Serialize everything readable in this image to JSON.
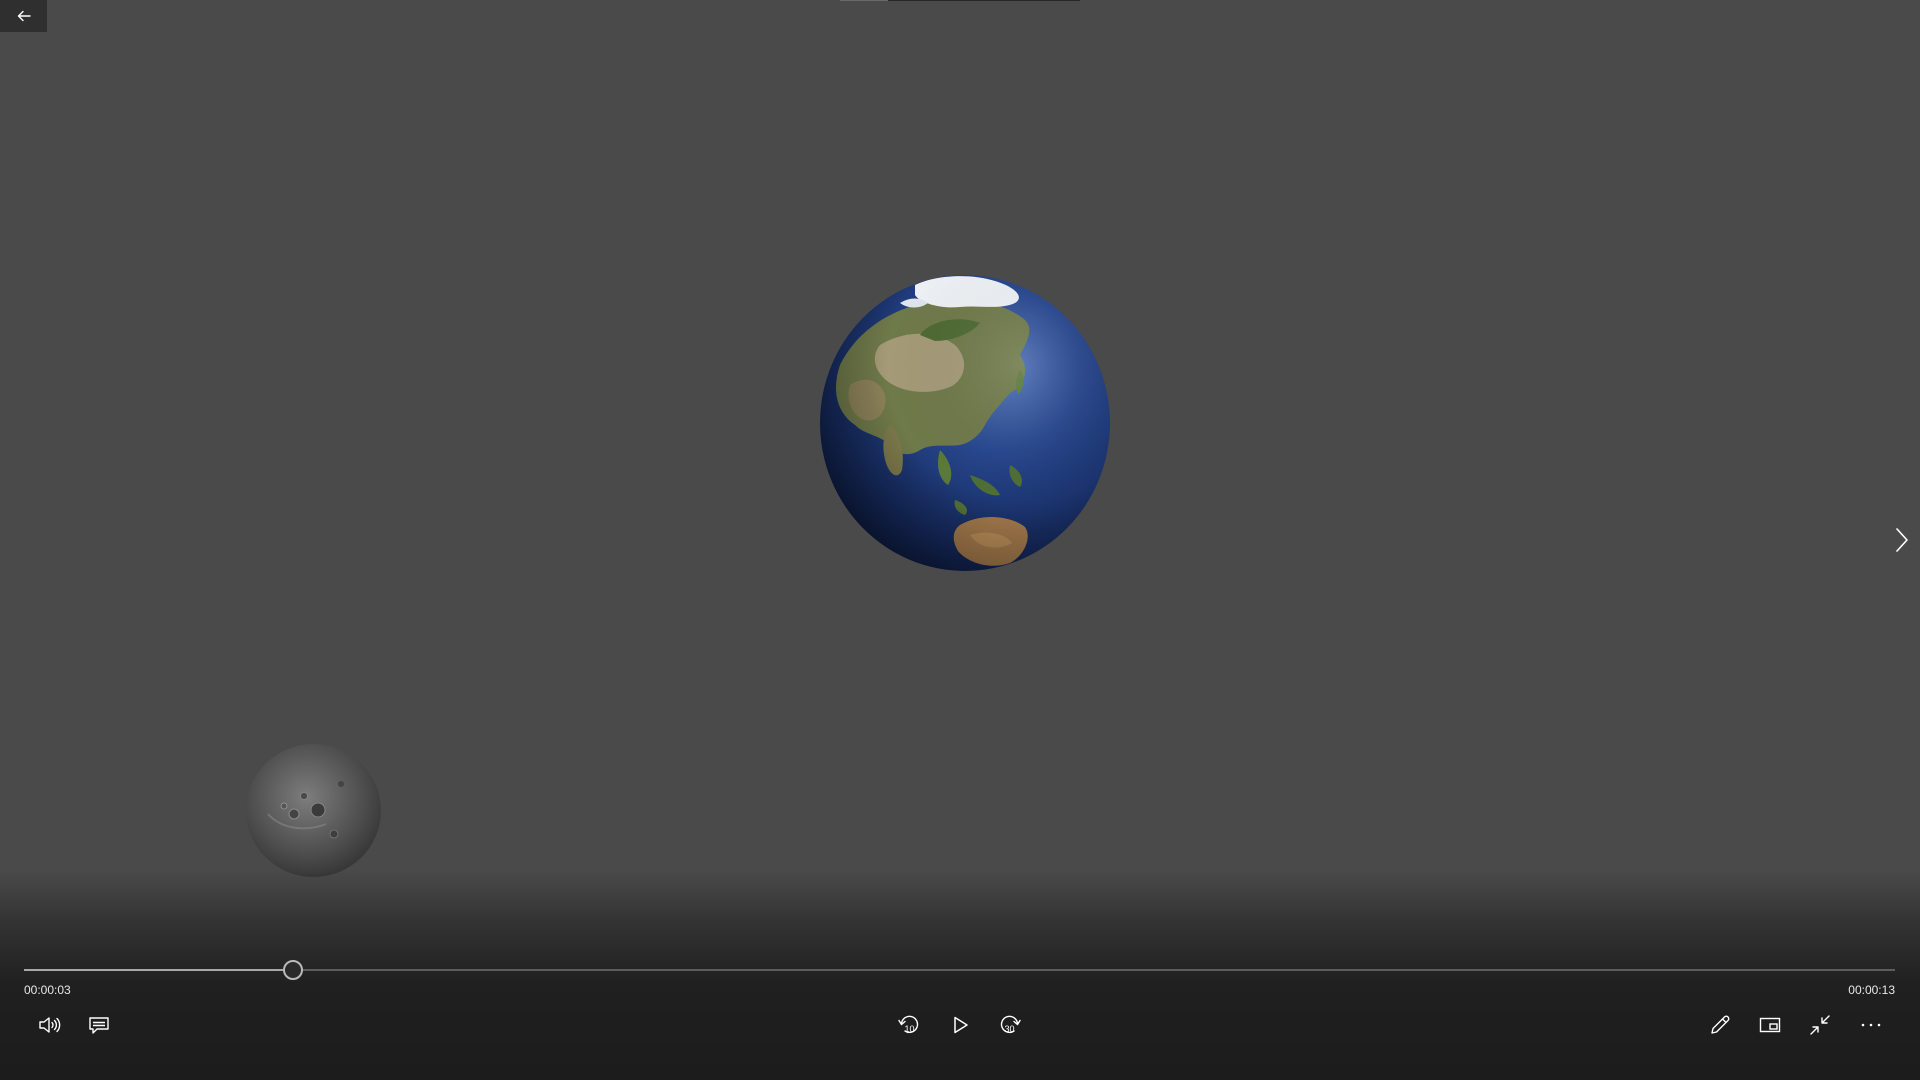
{
  "window": {
    "back_button": "back-arrow-icon"
  },
  "media": {
    "scene": [
      "earth-globe",
      "moon"
    ]
  },
  "playback": {
    "current_time": "00:00:03",
    "total_time": "00:00:13",
    "progress_fraction": 0.1437,
    "state": "paused"
  },
  "controls": {
    "left": [
      "volume-icon",
      "subtitles-icon"
    ],
    "center": [
      "skip-back-10-icon",
      "play-icon",
      "skip-forward-30-icon"
    ],
    "right": [
      "edit-pencil-icon",
      "mini-view-icon",
      "exit-fullscreen-icon",
      "more-options-icon"
    ],
    "skip_back_seconds": "10",
    "skip_forward_seconds": "30"
  },
  "colors": {
    "background": "#4a4a4a",
    "control_bar": "#1c1c1c",
    "icon": "#ffffff",
    "seek_fill": "#a8a8a8",
    "seek_track": "#5d5d5d"
  }
}
